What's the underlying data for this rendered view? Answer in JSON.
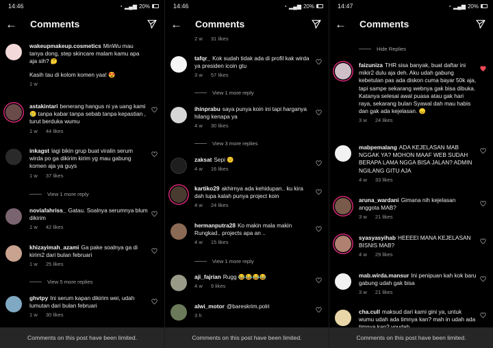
{
  "panels": [
    {
      "status": {
        "time": "14:46",
        "battery": "20%"
      },
      "header": {
        "title": "Comments"
      },
      "top_comment": {
        "user": "wakeupmakeup.cosmetics",
        "text": "MinWu mau tanya dong, step skincare malam kamu apa aja sih? 🤔",
        "text2": "Kasih tau di kolom komen yaa! 😍",
        "time": "1 w"
      },
      "comments": [
        {
          "user": "astakintari",
          "text": "benerang hangus ni ya uang kami 🥲 tanpa kabar tanpa sebab tanpa kepastian , turut berduka wumu",
          "time": "1 w",
          "likes": "44 likes"
        },
        {
          "user": "inkagst",
          "text": "lagi bikin grup buat viralin serum wirda po ga dikirim kirim yg mau gabung komen aja ya guys",
          "time": "1 w",
          "likes": "37 likes"
        },
        {
          "user": "noviafahriss_",
          "text": "Gatau. Soalnya serumnya blum dikirim",
          "time": "1 w",
          "likes": "42 likes"
        },
        {
          "user": "khizayimah_azami",
          "text": "Ga pake soalnya ga di kirim2 dari bulan februari",
          "time": "1 w",
          "likes": "25 likes"
        },
        {
          "user": "ghvtpy",
          "text": "Ini serum kapan dikirim wei, udah lumutan dari bulan februari",
          "time": "1 w",
          "likes": "30 likes"
        }
      ],
      "view_more": [
        "View 1 more reply",
        "View 5 more replies"
      ],
      "footer": "Comments on this post have been limited."
    },
    {
      "status": {
        "time": "14:46",
        "battery": "20%"
      },
      "header": {
        "title": "Comments"
      },
      "partial": {
        "time": "2 w",
        "likes": "31 likes"
      },
      "comments": [
        {
          "user": "tafqr_",
          "text": "Kok sudah tidak ada di profil kak wirda ya presiden icoin gtu",
          "time": "3 w",
          "likes": "57 likes"
        },
        {
          "user": "ihinprabu",
          "text": "saya punya koin ini tapi harganya hilang kenapa ya",
          "time": "4 w",
          "likes": "30 likes"
        },
        {
          "user": "zaksat",
          "text": "Sepi 😕",
          "time": "4 w",
          "likes": "16 likes"
        },
        {
          "user": "kartiko29",
          "text": "akhirnya ada kehidupan.. ku kira dah lupa kalah punya project koin",
          "time": "4 w",
          "likes": "24 likes"
        },
        {
          "user": "hermanputra28",
          "text": "Ko makin mala makin Rungkad.. projects apa an ..",
          "time": "4 w",
          "likes": "15 likes"
        },
        {
          "user": "aji_fajrian",
          "text": "Rugg 😂😂😂😂",
          "time": "4 w",
          "likes": "9 likes"
        },
        {
          "user": "alwi_motor",
          "text": "@bareskrim.polri",
          "time": "3 h",
          "likes": ""
        }
      ],
      "view_more": [
        "View 1 more reply",
        "View 3 more replies",
        "View 1 more reply"
      ],
      "footer": "Comments on this post have been limited."
    },
    {
      "status": {
        "time": "14:47",
        "battery": "20%"
      },
      "header": {
        "title": "Comments"
      },
      "hide_replies": "Hide Replies",
      "comments": [
        {
          "user": "faizuniza",
          "text": "THR sisa banyak, buat daftar ini mikir2 dulu aja deh. Aku udah gabung kebetulan pas ada diskon cuma bayar 50k aja, tapi sampe sekarang webnya gak bisa dibuka. Katanya selesai awal puasa atau gak hari raya, sekarang bulan Syawal dah mau habis dan gak ada kejelasan. 😞",
          "time": "3 w",
          "likes": "24 likes"
        },
        {
          "user": "mabpemalang",
          "text": "ADA KEJELASAN MAB NGGAK YA? MOHON MAAF WEB SUDAH BERAPA LAMA NGGA BISA JALAN? ADMIN NGILANG GITU AJA",
          "time": "4 w",
          "likes": "33 likes"
        },
        {
          "user": "aruna_wardani",
          "text": "Gimana nih kejelasan anggota MAB?",
          "time": "3 w",
          "likes": "21 likes"
        },
        {
          "user": "syasyasyihab",
          "text": "HEEEEI MANA KEJELASAN BISNIS MAB?",
          "time": "4 w",
          "likes": "29 likes"
        },
        {
          "user": "mab.wirda.mansur",
          "text": "Ini penipuan kah kok baru gabung udah gak bisa",
          "time": "3 w",
          "likes": "21 likes"
        },
        {
          "user": "cha.cull",
          "text": "maksud dari kami gini ya, untuk wumu udah ada timnya kan? mah in udah ada timnya kan? youdah",
          "time": "",
          "likes": ""
        }
      ],
      "footer": "Comments on this post have been limited."
    }
  ]
}
